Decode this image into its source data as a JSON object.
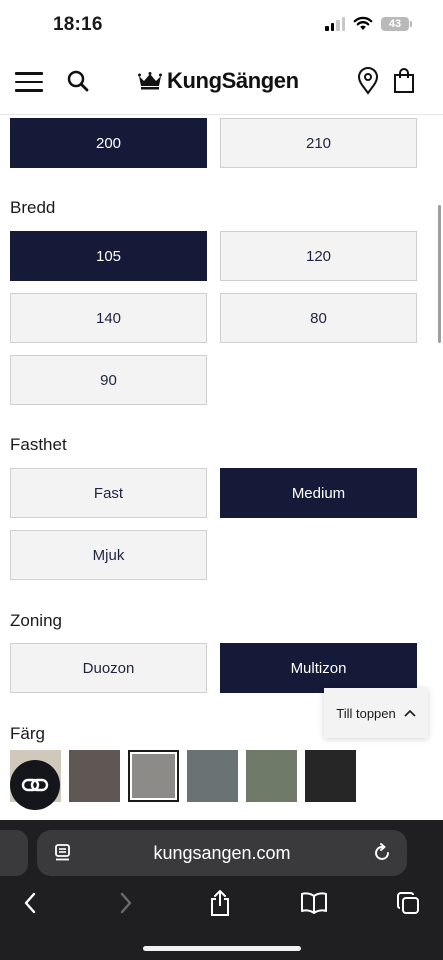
{
  "status_bar": {
    "time": "18:16",
    "battery": "43"
  },
  "header": {
    "logo_text": "KungSängen"
  },
  "length_options": [
    {
      "label": "200",
      "selected": true
    },
    {
      "label": "210",
      "selected": false
    }
  ],
  "width": {
    "label": "Bredd",
    "options": [
      {
        "label": "105",
        "selected": true
      },
      {
        "label": "120",
        "selected": false
      },
      {
        "label": "140",
        "selected": false
      },
      {
        "label": "80",
        "selected": false
      },
      {
        "label": "90",
        "selected": false
      }
    ]
  },
  "firmness": {
    "label": "Fasthet",
    "options": [
      {
        "label": "Fast",
        "selected": false
      },
      {
        "label": "Medium",
        "selected": true
      },
      {
        "label": "Mjuk",
        "selected": false
      }
    ]
  },
  "zoning": {
    "label": "Zoning",
    "options": [
      {
        "label": "Duozon",
        "selected": false
      },
      {
        "label": "Multizon",
        "selected": true
      }
    ]
  },
  "color": {
    "label": "Färg",
    "swatches": [
      {
        "color": "#cfc8bb",
        "selected": false
      },
      {
        "color": "#5f5754",
        "selected": false
      },
      {
        "color": "#8c8b87",
        "selected": true
      },
      {
        "color": "#6a7373",
        "selected": false
      },
      {
        "color": "#6f7a68",
        "selected": false
      },
      {
        "color": "#262626",
        "selected": false
      }
    ]
  },
  "to_top": {
    "label": "Till toppen"
  },
  "browser": {
    "url": "kungsangen.com"
  },
  "colors": {
    "selected_bg": "#141a38",
    "unselected_bg": "#f3f3f3",
    "browser_bar": "#1f1f21"
  }
}
